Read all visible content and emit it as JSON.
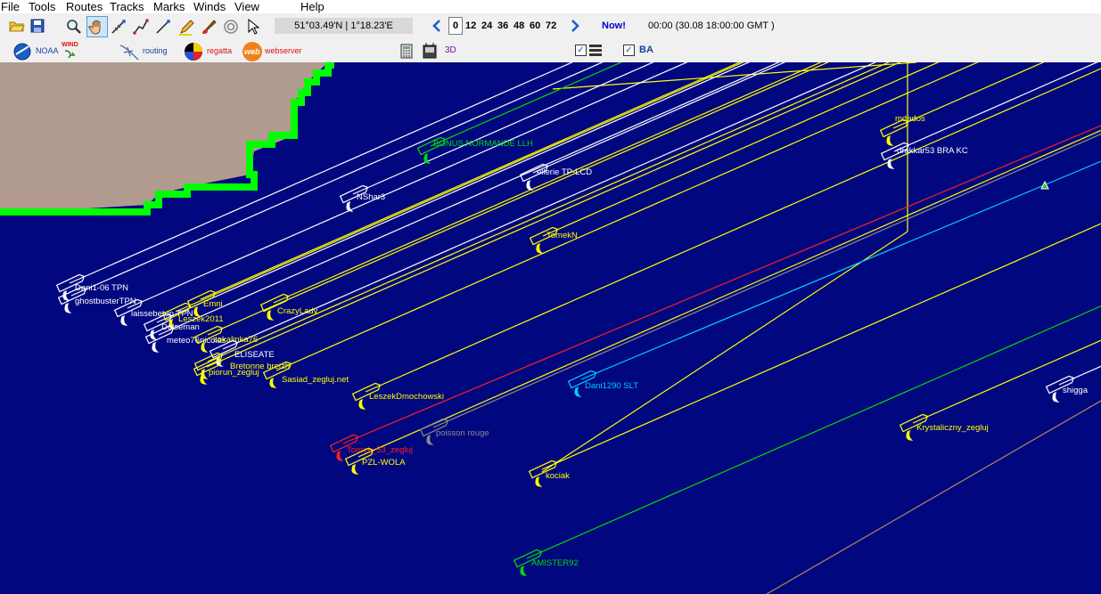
{
  "menu": [
    "File",
    "Tools",
    "Routes",
    "Tracks",
    "Marks",
    "Winds",
    "View",
    "Help"
  ],
  "toolbar": {
    "coordinates": "51°03.49'N | 1°18.23'E",
    "hour_selected": "0",
    "hours": [
      "12",
      "24",
      "36",
      "48",
      "60",
      "72"
    ],
    "now_label": "Now!",
    "time_label": "00:00 (30.08 18:00:00 GMT )"
  },
  "plugins": {
    "noaa": "NOAA",
    "wind": "WIND",
    "routing": "routing",
    "regatta": "regatta",
    "web": "web",
    "webserver": "webserver",
    "three_d": "3D",
    "ba": "BA"
  },
  "boats": [
    {
      "name": "BONUS NORMANDE LLH",
      "color": "#00dd00"
    },
    {
      "name": "mdados",
      "color": "#ffff00"
    },
    {
      "name": "drakkar53 BRA KC",
      "color": "#ffffff"
    },
    {
      "name": "ellerie TP-LCD",
      "color": "#ffffff"
    },
    {
      "name": "NShar3",
      "color": "#ffffff"
    },
    {
      "name": "TomekN",
      "color": "#ffff00"
    },
    {
      "name": "Dani1-06 TPN",
      "color": "#ffffff"
    },
    {
      "name": "ghostbusterTPN",
      "color": "#ffffff"
    },
    {
      "name": "Emni",
      "color": "#ffff00"
    },
    {
      "name": "laissebeton TPN",
      "color": "#ffffff"
    },
    {
      "name": "Leszek2011",
      "color": "#ffff00"
    },
    {
      "name": "CrazyLady",
      "color": "#ffff00"
    },
    {
      "name": "Dolseman",
      "color": "#ffffff"
    },
    {
      "name": "meteo76nicolas",
      "color": "#ffffff"
    },
    {
      "name": "sokalinka76",
      "color": "#ffff00"
    },
    {
      "name": "ELISEATE",
      "color": "#ffffff"
    },
    {
      "name": "Bretonne breizh",
      "color": "#ffff00"
    },
    {
      "name": "piorun_zegluj",
      "color": "#ffff00"
    },
    {
      "name": "Sasiad_zegluj.net",
      "color": "#ffff00"
    },
    {
      "name": "LeszekDmochowski",
      "color": "#ffff00"
    },
    {
      "name": "Dani1290 SLT",
      "color": "#00ccff"
    },
    {
      "name": "poisson rouge",
      "color": "#8a8a8a"
    },
    {
      "name": "Tomek_53_zegluj",
      "color": "#ff2020"
    },
    {
      "name": "PZL-WOLA",
      "color": "#ffff00"
    },
    {
      "name": "kociak",
      "color": "#ffff00"
    },
    {
      "name": "Krystaliczny_zegluj",
      "color": "#ffff00"
    },
    {
      "name": "shigga",
      "color": "#ffffff"
    },
    {
      "name": "AMISTER92",
      "color": "#00dd00"
    }
  ],
  "colors": {
    "sea": "#00077f",
    "land": "#b09b8e",
    "coast": "#00ff00"
  }
}
